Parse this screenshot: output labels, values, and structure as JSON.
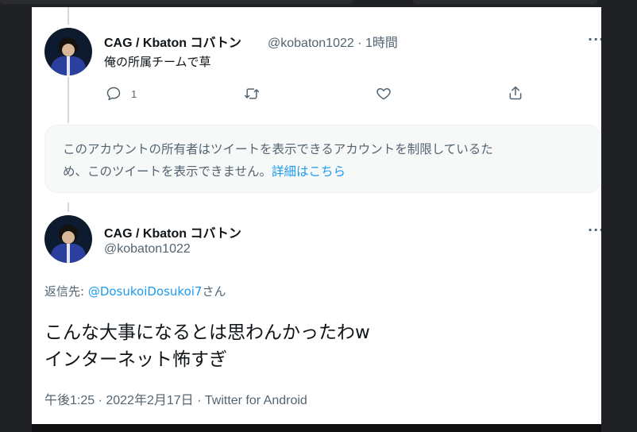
{
  "tweet1": {
    "display_name": "CAG / Kbaton コバトン",
    "handle_time": "@kobaton1022 · 1時間",
    "text": "俺の所属チームで草",
    "more": "···",
    "reply_count": "1",
    "icons": [
      "reply-icon",
      "retweet-icon",
      "like-icon",
      "share-icon"
    ]
  },
  "notice": {
    "line1": "このアカウントの所有者はツイートを表示できるアカウントを制限しているた",
    "line2": "め、このツイートを表示できません。",
    "link": "詳細はこちら"
  },
  "tweet2": {
    "display_name": "CAG / Kbaton コバトン",
    "handle": "@kobaton1022",
    "more": "···",
    "reply_prefix": "返信先: ",
    "reply_to": "@DosukoiDosukoi7",
    "reply_suffix": "さん",
    "text_line1": "こんな大事になるとは思わんかったわw",
    "text_line2": "インターネット怖すぎ",
    "timestamp": "午後1:25 · 2022年2月17日 · Twitter for Android"
  },
  "colors": {
    "link": "#1d9bf0",
    "muted": "#536471",
    "text": "#0f1419",
    "background": "#202124"
  }
}
